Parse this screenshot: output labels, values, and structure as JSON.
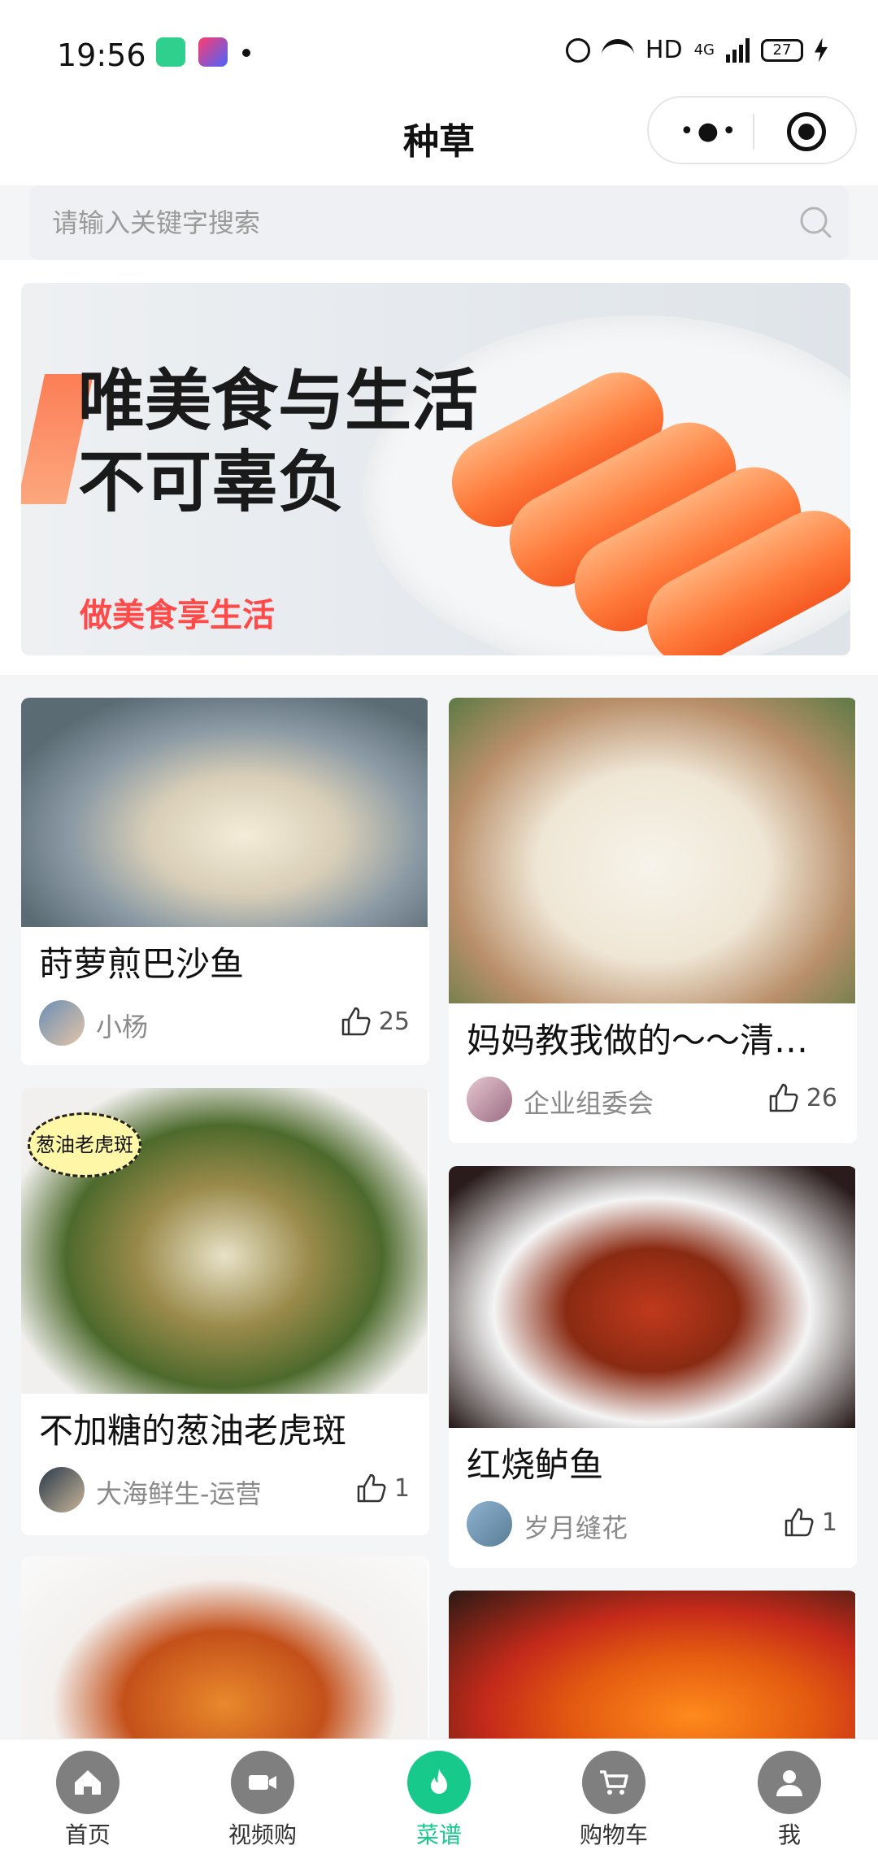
{
  "status_bar": {
    "time": "19:56",
    "network": "HD",
    "signal": "4G",
    "battery": "27"
  },
  "nav": {
    "title": "种草"
  },
  "search": {
    "placeholder": "请输入关键字搜索"
  },
  "banner": {
    "headline_line1": "唯美食与生活",
    "headline_line2": "不可辜负",
    "tagline": "做美食享生活"
  },
  "feed": [
    {
      "title": "莳萝煎巴沙鱼",
      "author": "小杨",
      "likes": "25"
    },
    {
      "title": "妈妈教我做的～～清…",
      "author": "企业组委会",
      "likes": "26"
    },
    {
      "title": "不加糖的葱油老虎斑",
      "author": "大海鲜生-运营",
      "likes": "1",
      "image_label": "葱油老虎斑"
    },
    {
      "title": "红烧鲈鱼",
      "author": "岁月缝花",
      "likes": "1"
    }
  ],
  "tabbar": [
    {
      "label": "首页",
      "icon": "home-icon",
      "active": false
    },
    {
      "label": "视频购",
      "icon": "video-camera-icon",
      "active": false
    },
    {
      "label": "菜谱",
      "icon": "flame-icon",
      "active": true
    },
    {
      "label": "购物车",
      "icon": "cart-icon",
      "active": false
    },
    {
      "label": "我",
      "icon": "person-icon",
      "active": false
    }
  ],
  "colors": {
    "accent": "#17c98b",
    "inactive_icon": "#7f7f7f",
    "banner_red": "#ff4a4a"
  }
}
